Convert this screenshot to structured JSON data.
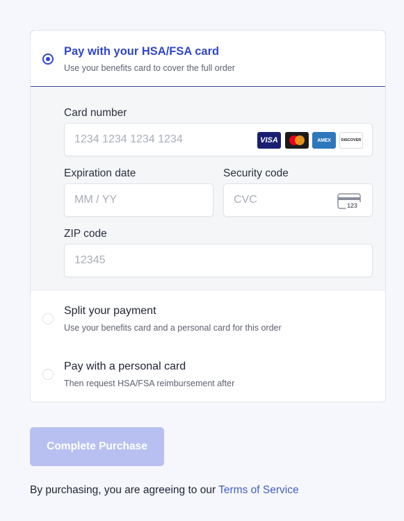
{
  "payment_options": {
    "hsa": {
      "title": "Pay with your HSA/FSA card",
      "subtitle": "Use your benefits card to cover the full order",
      "selected": true
    },
    "split": {
      "title": "Split your payment",
      "subtitle": "Use your benefits card and a personal card for this order",
      "selected": false
    },
    "personal": {
      "title": "Pay with a personal card",
      "subtitle": "Then request HSA/FSA reimbursement after",
      "selected": false
    }
  },
  "card_form": {
    "card_number": {
      "label": "Card number",
      "value": "",
      "placeholder": "1234 1234 1234 1234"
    },
    "expiration": {
      "label": "Expiration date",
      "value": "",
      "placeholder": "MM / YY"
    },
    "security": {
      "label": "Security code",
      "value": "",
      "placeholder": "CVC"
    },
    "zip": {
      "label": "ZIP code",
      "value": "",
      "placeholder": "12345"
    },
    "brands": [
      "VISA",
      "AMEX",
      "DISCOVER"
    ],
    "cvc_icon_text": "123"
  },
  "submit": {
    "label": "Complete Purchase",
    "enabled": false
  },
  "terms": {
    "prefix": "By purchasing, you are agreeing to our ",
    "link": "Terms of Service"
  },
  "colors": {
    "accent": "#2f46c9",
    "button_disabled": "#b7c0f0",
    "link": "#3f5ec6",
    "background": "#f6f7fc"
  }
}
